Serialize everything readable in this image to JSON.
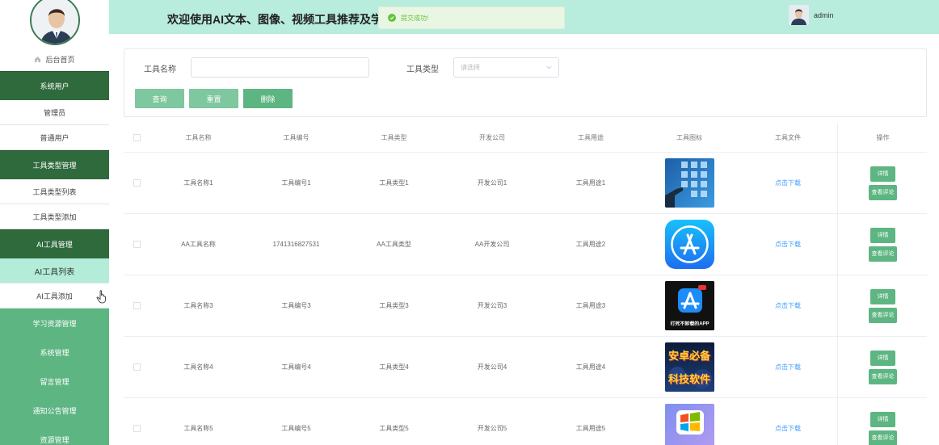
{
  "sidebar": {
    "home": "后台首页",
    "groups": [
      {
        "label": "系统用户",
        "items": [
          "管理员",
          "普通用户"
        ]
      },
      {
        "label": "工具类型管理",
        "items": [
          "工具类型列表",
          "工具类型添加"
        ]
      },
      {
        "label": "AI工具管理",
        "items": [
          "AI工具列表",
          "AI工具添加"
        ]
      }
    ],
    "plain_items": [
      "学习资源管理",
      "系统管理",
      "留言管理",
      "通知公告管理",
      "资源管理"
    ]
  },
  "header": {
    "title": "欢迎使用AI文本、图像、视频工具推荐及学习系统",
    "toast": "提交成功!",
    "username": "admin"
  },
  "search": {
    "name_label": "工具名称",
    "name_value": "",
    "type_label": "工具类型",
    "type_placeholder": "请选择",
    "query_btn": "查询",
    "reset_btn": "重置",
    "delete_btn": "删除"
  },
  "table": {
    "headers": [
      "工具名称",
      "工具编号",
      "工具类型",
      "开发公司",
      "工具用途",
      "工具图标",
      "工具文件",
      "操作"
    ],
    "rows": [
      {
        "name": "工具名称1",
        "no": "工具编号1",
        "type": "工具类型1",
        "company": "开发公司1",
        "use": "工具用途1",
        "icon": "tech-touch-icon",
        "file": "点击下载"
      },
      {
        "name": "AA工具名称",
        "no": "1741316827531",
        "type": "AA工具类型",
        "company": "AA开发公司",
        "use": "工具用途2",
        "icon": "app-store-icon",
        "file": "点击下载"
      },
      {
        "name": "工具名称3",
        "no": "工具编号3",
        "type": "工具类型3",
        "company": "开发公司3",
        "use": "工具用途3",
        "icon": "app-store-dark-icon",
        "icon_caption": "打死不卸载的APP",
        "file": "点击下载"
      },
      {
        "name": "工具名称4",
        "no": "工具编号4",
        "type": "工具类型4",
        "company": "开发公司4",
        "use": "工具用途4",
        "icon": "android-poster-icon",
        "icon_caption": "安卓必备 科技软件",
        "file": "点击下载"
      },
      {
        "name": "工具名称5",
        "no": "工具编号5",
        "type": "工具类型5",
        "company": "开发公司5",
        "use": "工具用途5",
        "icon": "windows-logo-icon",
        "file": "点击下载"
      }
    ],
    "detail_btn": "详情",
    "review_btn": "查看评论"
  },
  "colors": {
    "primary": "#5db582",
    "dark_group": "#2f6a3d",
    "header_bg": "#b8ecdc",
    "active_sub": "#b3ecd8",
    "link": "#409eff"
  }
}
